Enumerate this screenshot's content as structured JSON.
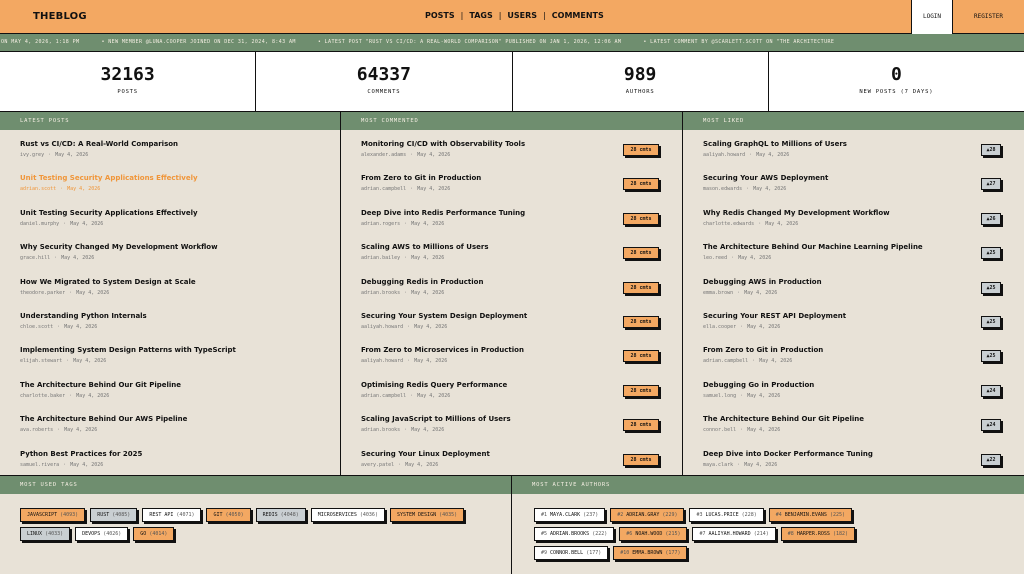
{
  "header": {
    "logo": "THEBLOG",
    "nav": [
      "POSTS",
      "TAGS",
      "USERS",
      "COMMENTS"
    ],
    "nav_sep": "|",
    "login": "LOGIN",
    "register": "REGISTER"
  },
  "ticker": [
    "ON MAY 4, 2026, 1:18 PM",
    "• NEW MEMBER @LUNA.COOPER JOINED ON DEC 31, 2024, 8:43 AM",
    "• LATEST POST \"RUST VS CI/CD: A REAL-WORLD COMPARISON\" PUBLISHED ON JAN 1, 2026, 12:06 AM",
    "• LATEST COMMENT BY @SCARLETT.SCOTT ON \"THE ARCHITECTURE"
  ],
  "stats": [
    {
      "value": "32163",
      "label": "POSTS"
    },
    {
      "value": "64337",
      "label": "COMMENTS"
    },
    {
      "value": "989",
      "label": "AUTHORS"
    },
    {
      "value": "0",
      "label": "NEW POSTS (7 DAYS)"
    }
  ],
  "latest_posts": {
    "heading": "LATEST POSTS",
    "items": [
      {
        "title": "Rust vs CI/CD: A Real-World Comparison",
        "author": "ivy.grey",
        "date": "May 4, 2026"
      },
      {
        "title": "Unit Testing Security Applications Effectively",
        "author": "adrian.scott",
        "date": "May 4, 2026",
        "highlight": true
      },
      {
        "title": "Unit Testing Security Applications Effectively",
        "author": "daniel.murphy",
        "date": "May 4, 2026"
      },
      {
        "title": "Why Security Changed My Development Workflow",
        "author": "grace.hill",
        "date": "May 4, 2026"
      },
      {
        "title": "How We Migrated to System Design at Scale",
        "author": "theodore.parker",
        "date": "May 4, 2026"
      },
      {
        "title": "Understanding Python Internals",
        "author": "chloe.scott",
        "date": "May 4, 2026"
      },
      {
        "title": "Implementing System Design Patterns with TypeScript",
        "author": "elijah.stewart",
        "date": "May 4, 2026"
      },
      {
        "title": "The Architecture Behind Our Git Pipeline",
        "author": "charlotte.baker",
        "date": "May 4, 2026"
      },
      {
        "title": "The Architecture Behind Our AWS Pipeline",
        "author": "ava.roberts",
        "date": "May 4, 2026"
      },
      {
        "title": "Python Best Practices for 2025",
        "author": "samuel.rivera",
        "date": "May 4, 2026"
      }
    ]
  },
  "most_commented": {
    "heading": "MOST COMMENTED",
    "items": [
      {
        "title": "Monitoring CI/CD with Observability Tools",
        "author": "alexander.adams",
        "date": "May 4, 2026",
        "badge": "28 cmts"
      },
      {
        "title": "From Zero to Git in Production",
        "author": "adrian.campbell",
        "date": "May 4, 2026",
        "badge": "28 cmts"
      },
      {
        "title": "Deep Dive into Redis Performance Tuning",
        "author": "adrian.rogers",
        "date": "May 4, 2026",
        "badge": "28 cmts"
      },
      {
        "title": "Scaling AWS to Millions of Users",
        "author": "adrian.bailey",
        "date": "May 4, 2026",
        "badge": "28 cmts"
      },
      {
        "title": "Debugging Redis in Production",
        "author": "adrian.brooks",
        "date": "May 4, 2026",
        "badge": "28 cmts"
      },
      {
        "title": "Securing Your System Design Deployment",
        "author": "aaliyah.howard",
        "date": "May 4, 2026",
        "badge": "28 cmts"
      },
      {
        "title": "From Zero to Microservices in Production",
        "author": "aaliyah.howard",
        "date": "May 4, 2026",
        "badge": "28 cmts"
      },
      {
        "title": "Optimising Redis Query Performance",
        "author": "adrian.campbell",
        "date": "May 4, 2026",
        "badge": "28 cmts"
      },
      {
        "title": "Scaling JavaScript to Millions of Users",
        "author": "adrian.brooks",
        "date": "May 4, 2026",
        "badge": "28 cmts"
      },
      {
        "title": "Securing Your Linux Deployment",
        "author": "avery.patel",
        "date": "May 4, 2026",
        "badge": "28 cmts"
      }
    ]
  },
  "most_liked": {
    "heading": "MOST LIKED",
    "items": [
      {
        "title": "Scaling GraphQL to Millions of Users",
        "author": "aaliyah.howard",
        "date": "May 4, 2026",
        "badge": "▲28"
      },
      {
        "title": "Securing Your AWS Deployment",
        "author": "mason.edwards",
        "date": "May 4, 2026",
        "badge": "▲27"
      },
      {
        "title": "Why Redis Changed My Development Workflow",
        "author": "charlotte.edwards",
        "date": "May 4, 2026",
        "badge": "▲26"
      },
      {
        "title": "The Architecture Behind Our Machine Learning Pipeline",
        "author": "leo.reed",
        "date": "May 4, 2026",
        "badge": "▲25"
      },
      {
        "title": "Debugging AWS in Production",
        "author": "emma.brown",
        "date": "May 4, 2026",
        "badge": "▲25"
      },
      {
        "title": "Securing Your REST API Deployment",
        "author": "ella.cooper",
        "date": "May 4, 2026",
        "badge": "▲25"
      },
      {
        "title": "From Zero to Git in Production",
        "author": "adrian.campbell",
        "date": "May 4, 2026",
        "badge": "▲25"
      },
      {
        "title": "Debugging Go in Production",
        "author": "samuel.long",
        "date": "May 4, 2026",
        "badge": "▲24"
      },
      {
        "title": "The Architecture Behind Our Git Pipeline",
        "author": "connor.bell",
        "date": "May 4, 2026",
        "badge": "▲24"
      },
      {
        "title": "Deep Dive into Docker Performance Tuning",
        "author": "maya.clark",
        "date": "May 4, 2026",
        "badge": "▲22"
      }
    ]
  },
  "meta_sep": "·",
  "most_used_tags": {
    "heading": "MOST USED TAGS",
    "items": [
      {
        "name": "JAVASCRIPT",
        "count": "(4093)",
        "style": "orange"
      },
      {
        "name": "RUST",
        "count": "(4085)",
        "style": "gray"
      },
      {
        "name": "REST API",
        "count": "(4071)",
        "style": "white"
      },
      {
        "name": "GIT",
        "count": "(4050)",
        "style": "orange"
      },
      {
        "name": "REDIS",
        "count": "(4048)",
        "style": "gray"
      },
      {
        "name": "MICROSERVICES",
        "count": "(4036)",
        "style": "white"
      },
      {
        "name": "SYSTEM DESIGN",
        "count": "(4035)",
        "style": "orange"
      },
      {
        "name": "LINUX",
        "count": "(4033)",
        "style": "gray"
      },
      {
        "name": "DEVOPS",
        "count": "(4026)",
        "style": "white"
      },
      {
        "name": "GO",
        "count": "(4014)",
        "style": "orange"
      }
    ]
  },
  "most_active_authors": {
    "heading": "MOST ACTIVE AUTHORS",
    "items": [
      {
        "rank": "#1",
        "name": "MAYA.CLARK",
        "count": "(237)",
        "style": "white"
      },
      {
        "rank": "#2",
        "name": "ADRIAN.GRAY",
        "count": "(229)",
        "style": "orange"
      },
      {
        "rank": "#3",
        "name": "LUCAS.PRICE",
        "count": "(228)",
        "style": "white"
      },
      {
        "rank": "#4",
        "name": "BENJAMIN.EVANS",
        "count": "(225)",
        "style": "orange"
      },
      {
        "rank": "#5",
        "name": "ADRIAN.BROOKS",
        "count": "(222)",
        "style": "white"
      },
      {
        "rank": "#6",
        "name": "NOAH.WOOD",
        "count": "(215)",
        "style": "orange"
      },
      {
        "rank": "#7",
        "name": "AALIYAH.HOWARD",
        "count": "(214)",
        "style": "white"
      },
      {
        "rank": "#8",
        "name": "HARPER.ROSS",
        "count": "(182)",
        "style": "orange"
      },
      {
        "rank": "#9",
        "name": "CONNOR.BELL",
        "count": "(177)",
        "style": "white"
      },
      {
        "rank": "#10",
        "name": "EMMA.BROWN",
        "count": "(177)",
        "style": "orange"
      }
    ]
  }
}
